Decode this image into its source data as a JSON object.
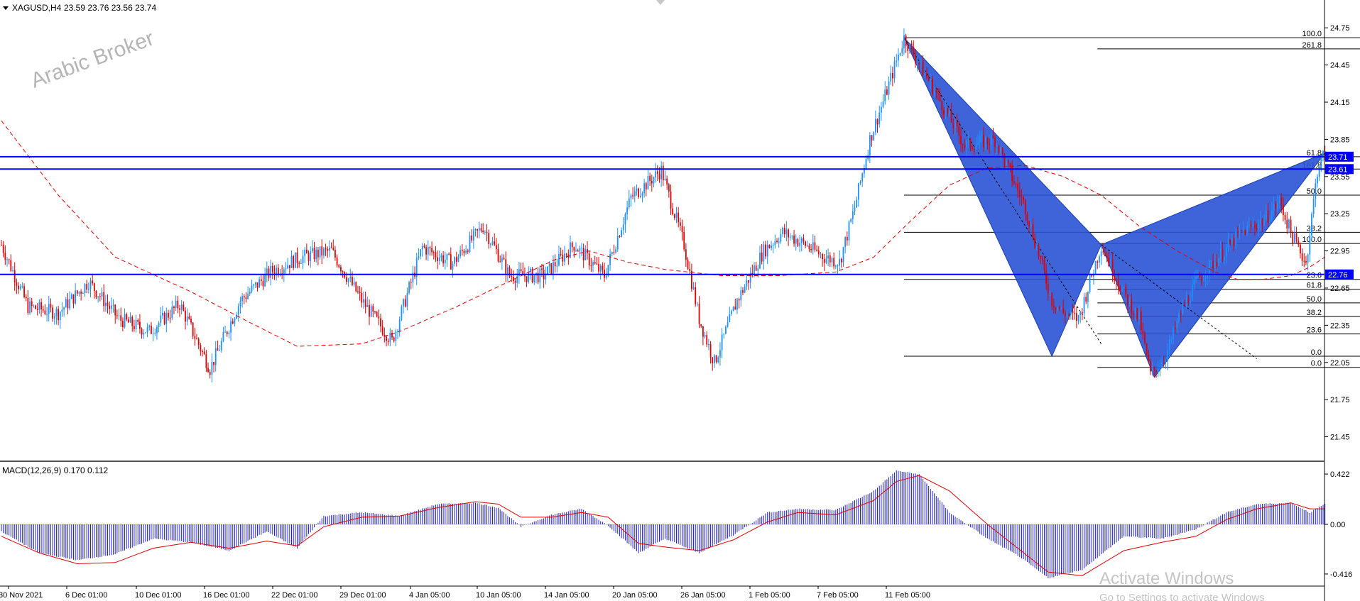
{
  "window": {
    "title": "XAGUSD,H4",
    "ohlc": "23.59 23.76 23.56 23.74"
  },
  "watermark": "Arabic Broker",
  "activation": {
    "title": "Activate Windows",
    "subtitle": "Go to Settings to activate Windows"
  },
  "chart_data": [
    {
      "type": "candlestick",
      "symbol": "XAGUSD",
      "timeframe": "H4",
      "ylim": [
        21.31,
        24.86
      ],
      "yticks": [
        "24.75",
        "24.45",
        "24.15",
        "23.85",
        "23.55",
        "23.25",
        "22.95",
        "22.65",
        "22.35",
        "22.05",
        "21.75",
        "21.45"
      ],
      "xticks": [
        "30 Nov 2021",
        "6 Dec 01:00",
        "10 Dec 01:00",
        "16 Dec 01:00",
        "22 Dec 01:00",
        "29 Dec 01:00",
        "4 Jan 05:00",
        "10 Jan 05:00",
        "14 Jan 05:00",
        "20 Jan 05:00",
        "26 Jan 05:00",
        "1 Feb 05:00",
        "7 Feb 05:00",
        "11 Feb 05:00"
      ],
      "colors": {
        "up": "#1e90ff",
        "down": "#e00000",
        "ma": "#e00000",
        "pattern": "#2a52d4",
        "hline": "#0000ff"
      },
      "price_path": [
        [
          0,
          23.0
        ],
        [
          14,
          22.5
        ],
        [
          30,
          22.45
        ],
        [
          46,
          22.7
        ],
        [
          62,
          22.4
        ],
        [
          78,
          22.3
        ],
        [
          94,
          22.52
        ],
        [
          110,
          22.0
        ],
        [
          126,
          22.55
        ],
        [
          142,
          22.78
        ],
        [
          158,
          22.9
        ],
        [
          174,
          22.95
        ],
        [
          190,
          22.55
        ],
        [
          206,
          22.22
        ],
        [
          222,
          22.98
        ],
        [
          238,
          22.85
        ],
        [
          254,
          23.15
        ],
        [
          268,
          22.75
        ],
        [
          286,
          22.75
        ],
        [
          302,
          23.0
        ],
        [
          318,
          22.75
        ],
        [
          332,
          23.38
        ],
        [
          348,
          23.6
        ],
        [
          360,
          23.0
        ],
        [
          368,
          22.4
        ],
        [
          376,
          22.05
        ],
        [
          388,
          22.55
        ],
        [
          402,
          22.95
        ],
        [
          412,
          23.1
        ],
        [
          424,
          23.0
        ],
        [
          434,
          22.9
        ],
        [
          442,
          22.86
        ],
        [
          450,
          23.3
        ],
        [
          458,
          23.85
        ],
        [
          466,
          24.2
        ],
        [
          476,
          24.67
        ],
        [
          490,
          24.3
        ],
        [
          508,
          23.8
        ],
        [
          524,
          23.85
        ],
        [
          540,
          23.3
        ],
        [
          554,
          22.55
        ],
        [
          560,
          22.45
        ],
        [
          568,
          22.4
        ],
        [
          580,
          23.0
        ],
        [
          592,
          22.6
        ],
        [
          600,
          22.4
        ],
        [
          606,
          21.95
        ],
        [
          614,
          22.1
        ],
        [
          622,
          22.45
        ],
        [
          630,
          22.7
        ],
        [
          642,
          22.9
        ],
        [
          654,
          23.1
        ],
        [
          666,
          23.2
        ],
        [
          674,
          23.35
        ],
        [
          680,
          23.1
        ],
        [
          688,
          22.85
        ],
        [
          694,
          23.6
        ],
        [
          698,
          23.74
        ]
      ],
      "ma_path": [
        [
          0,
          24.0
        ],
        [
          30,
          23.4
        ],
        [
          60,
          22.9
        ],
        [
          100,
          22.62
        ],
        [
          130,
          22.38
        ],
        [
          156,
          22.18
        ],
        [
          190,
          22.2
        ],
        [
          210,
          22.3
        ],
        [
          240,
          22.5
        ],
        [
          270,
          22.72
        ],
        [
          292,
          22.88
        ],
        [
          310,
          22.95
        ],
        [
          330,
          22.86
        ],
        [
          350,
          22.8
        ],
        [
          380,
          22.75
        ],
        [
          410,
          22.75
        ],
        [
          440,
          22.78
        ],
        [
          460,
          22.9
        ],
        [
          480,
          23.2
        ],
        [
          500,
          23.48
        ],
        [
          520,
          23.62
        ],
        [
          540,
          23.64
        ],
        [
          560,
          23.55
        ],
        [
          580,
          23.4
        ],
        [
          600,
          23.15
        ],
        [
          620,
          22.95
        ],
        [
          640,
          22.78
        ],
        [
          652,
          22.72
        ],
        [
          665,
          22.72
        ],
        [
          680,
          22.75
        ],
        [
          690,
          22.82
        ],
        [
          698,
          22.9
        ]
      ],
      "harmonic_pattern": [
        [
          476,
          24.67
        ],
        [
          554,
          22.1
        ],
        [
          580,
          23.0
        ],
        [
          608,
          21.93
        ],
        [
          698,
          23.74
        ]
      ],
      "dotted_lines": [
        [
          [
            476,
            24.67
          ],
          [
            580,
            22.2
          ]
        ],
        [
          [
            580,
            23.0
          ],
          [
            662,
            22.08
          ]
        ]
      ],
      "horizontal_lines": [
        {
          "price": 23.71,
          "label": "23.71",
          "color": "#0000ff"
        },
        {
          "price": 23.61,
          "label": "23.61",
          "color": "#0000ff"
        },
        {
          "price": 22.76,
          "label": "22.76",
          "color": "#0000ff"
        }
      ],
      "fibonacci": [
        {
          "x_from": 476,
          "x_to": 1012,
          "levels": [
            {
              "label": "100.0",
              "price": 24.67
            },
            {
              "label": "61.8",
              "price": 23.71
            },
            {
              "label": "50.0",
              "price": 23.4
            },
            {
              "label": "38.2",
              "price": 23.1
            },
            {
              "label": "23.6",
              "price": 22.72
            },
            {
              "label": "0.0",
              "price": 22.1
            }
          ]
        },
        {
          "x_from": 578,
          "x_to": 1012,
          "levels": [
            {
              "label": "261.8",
              "price": 24.58
            },
            {
              "label": "161.8",
              "price": 23.61
            },
            {
              "label": "100.0",
              "price": 23.01
            },
            {
              "label": "61.8",
              "price": 22.64
            },
            {
              "label": "50.0",
              "price": 22.53
            },
            {
              "label": "38.2",
              "price": 22.42
            },
            {
              "label": "23.6",
              "price": 22.28
            },
            {
              "label": "0.0",
              "price": 22.01
            }
          ]
        }
      ]
    },
    {
      "type": "histogram",
      "title": "MACD(12,26,9) 0.170 0.112",
      "ylim": [
        -0.47,
        0.47
      ],
      "yticks": [
        "0.422",
        "0.00",
        "-0.416"
      ],
      "colors": {
        "bars": "#2020cc",
        "signal": "#e00000"
      },
      "macd_path": [
        [
          0,
          -0.06
        ],
        [
          20,
          -0.24
        ],
        [
          40,
          -0.3
        ],
        [
          60,
          -0.25
        ],
        [
          80,
          -0.12
        ],
        [
          100,
          -0.15
        ],
        [
          120,
          -0.22
        ],
        [
          140,
          -0.06
        ],
        [
          156,
          -0.2
        ],
        [
          170,
          0.07
        ],
        [
          190,
          0.1
        ],
        [
          210,
          0.07
        ],
        [
          230,
          0.17
        ],
        [
          250,
          0.18
        ],
        [
          262,
          0.14
        ],
        [
          274,
          -0.02
        ],
        [
          290,
          0.08
        ],
        [
          306,
          0.13
        ],
        [
          320,
          -0.01
        ],
        [
          336,
          -0.24
        ],
        [
          350,
          -0.12
        ],
        [
          368,
          -0.24
        ],
        [
          386,
          -0.09
        ],
        [
          404,
          0.1
        ],
        [
          420,
          0.13
        ],
        [
          440,
          0.12
        ],
        [
          460,
          0.28
        ],
        [
          472,
          0.45
        ],
        [
          484,
          0.42
        ],
        [
          500,
          0.1
        ],
        [
          520,
          -0.12
        ],
        [
          536,
          -0.26
        ],
        [
          552,
          -0.45
        ],
        [
          570,
          -0.38
        ],
        [
          592,
          -0.1
        ],
        [
          612,
          -0.12
        ],
        [
          630,
          -0.04
        ],
        [
          646,
          0.1
        ],
        [
          662,
          0.17
        ],
        [
          680,
          0.18
        ],
        [
          690,
          0.1
        ],
        [
          698,
          0.17
        ]
      ],
      "signal_path": [
        [
          0,
          -0.1
        ],
        [
          20,
          -0.24
        ],
        [
          40,
          -0.33
        ],
        [
          60,
          -0.32
        ],
        [
          80,
          -0.2
        ],
        [
          100,
          -0.15
        ],
        [
          120,
          -0.2
        ],
        [
          140,
          -0.14
        ],
        [
          156,
          -0.18
        ],
        [
          170,
          -0.02
        ],
        [
          190,
          0.06
        ],
        [
          210,
          0.07
        ],
        [
          230,
          0.14
        ],
        [
          250,
          0.19
        ],
        [
          262,
          0.17
        ],
        [
          274,
          0.06
        ],
        [
          290,
          0.06
        ],
        [
          306,
          0.1
        ],
        [
          320,
          0.06
        ],
        [
          336,
          -0.16
        ],
        [
          350,
          -0.19
        ],
        [
          368,
          -0.22
        ],
        [
          386,
          -0.13
        ],
        [
          404,
          0.02
        ],
        [
          420,
          0.1
        ],
        [
          440,
          0.08
        ],
        [
          460,
          0.2
        ],
        [
          472,
          0.36
        ],
        [
          484,
          0.41
        ],
        [
          500,
          0.28
        ],
        [
          520,
          0.0
        ],
        [
          536,
          -0.2
        ],
        [
          552,
          -0.4
        ],
        [
          570,
          -0.43
        ],
        [
          592,
          -0.22
        ],
        [
          612,
          -0.15
        ],
        [
          630,
          -0.1
        ],
        [
          646,
          0.04
        ],
        [
          662,
          0.13
        ],
        [
          680,
          0.18
        ],
        [
          690,
          0.13
        ],
        [
          698,
          0.13
        ]
      ]
    }
  ]
}
